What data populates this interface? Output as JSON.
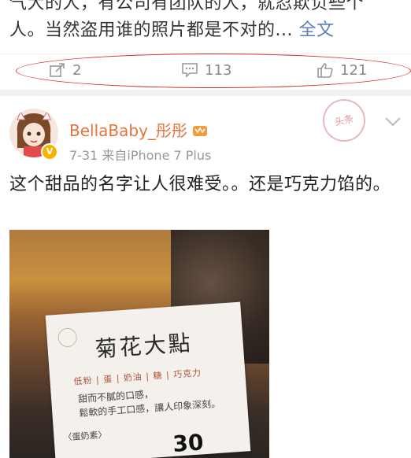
{
  "top_post": {
    "text_line1": "气大的人，有公司有团队的人，就忍欺负些个",
    "text_line2": "人。当然盗用谁的照片都是不对的...",
    "full_text_link": "全文",
    "repost_count": "2",
    "comment_count": "113",
    "like_count": "121"
  },
  "post": {
    "username": "BellaBaby_彤彤",
    "date": "7-31",
    "source": "来自iPhone 7 Plus",
    "stamp_text": "头条",
    "body": "这个甜品的名字让人很难受。。还是巧克力馅的。",
    "photo": {
      "sign_name": "菊花大點",
      "ingredients": "低粉 | 蛋 | 奶油 | 糖 | 巧克力",
      "desc_line1": "甜而不膩的口感，",
      "desc_line2": "鬆軟的手工口感，讓人印象深刻。",
      "tag": "〈蛋奶素〉",
      "price": "30"
    }
  },
  "colors": {
    "username": "#e8733a",
    "link": "#5b7fb2",
    "highlight_ellipse": "#d62828"
  }
}
